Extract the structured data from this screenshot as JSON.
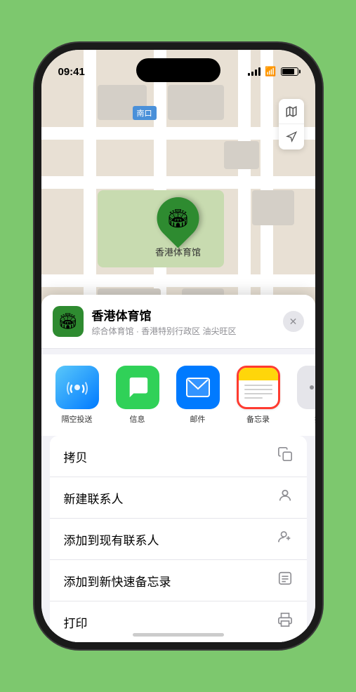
{
  "status": {
    "time": "09:41",
    "location_arrow": "▶"
  },
  "map": {
    "label": "南口",
    "venue_pin_emoji": "🏟",
    "venue_pin_label": "香港体育馆"
  },
  "sheet": {
    "venue_icon_emoji": "🏟",
    "venue_name": "香港体育馆",
    "venue_desc": "综合体育馆 · 香港特别行政区 油尖旺区",
    "close_label": "✕"
  },
  "share_items": [
    {
      "id": "airdrop",
      "label": "隔空投送",
      "type": "airdrop"
    },
    {
      "id": "message",
      "label": "信息",
      "type": "message"
    },
    {
      "id": "mail",
      "label": "邮件",
      "type": "mail"
    },
    {
      "id": "notes",
      "label": "备忘录",
      "type": "notes"
    }
  ],
  "more_icon_label": "提",
  "actions": [
    {
      "id": "copy",
      "label": "拷贝",
      "icon": "copy"
    },
    {
      "id": "new-contact",
      "label": "新建联系人",
      "icon": "person"
    },
    {
      "id": "add-contact",
      "label": "添加到现有联系人",
      "icon": "person-add"
    },
    {
      "id": "quick-note",
      "label": "添加到新快速备忘录",
      "icon": "note"
    },
    {
      "id": "print",
      "label": "打印",
      "icon": "print"
    }
  ]
}
